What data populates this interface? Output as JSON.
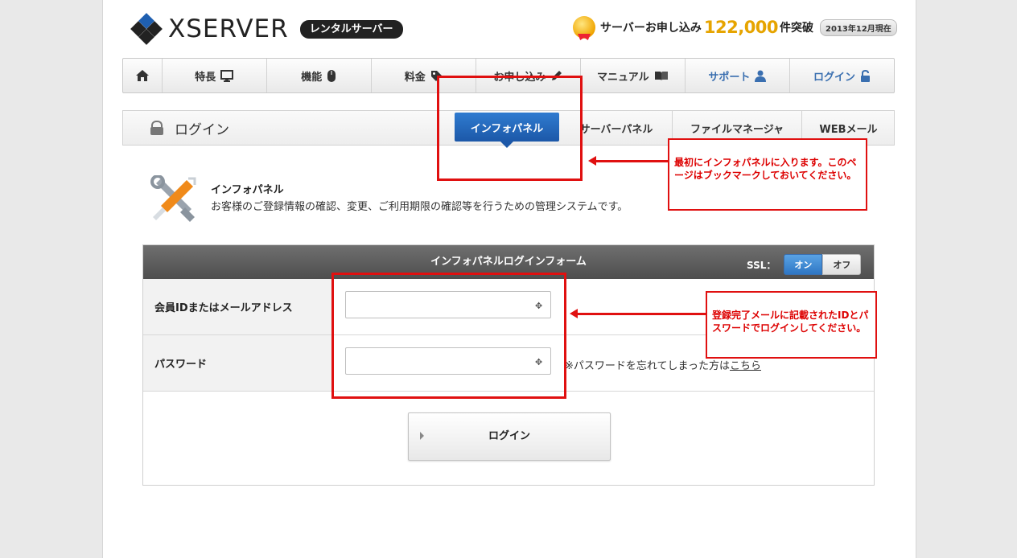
{
  "header": {
    "logo_text": "XSERVER",
    "logo_badge": "レンタルサーバー",
    "promo_text": "サーバーお申し込み",
    "promo_number": "122,000",
    "promo_suffix": "件突破",
    "promo_date": "2013年12月現在"
  },
  "nav": {
    "items": [
      {
        "label": "特長",
        "icon": "monitor-icon"
      },
      {
        "label": "機能",
        "icon": "mouse-icon"
      },
      {
        "label": "料金",
        "icon": "tag-icon"
      },
      {
        "label": "お申し込み",
        "icon": "pencil-icon"
      },
      {
        "label": "マニュアル",
        "icon": "book-icon"
      },
      {
        "label": "サポート",
        "icon": "person-icon"
      },
      {
        "label": "ログイン",
        "icon": "lock-icon"
      }
    ]
  },
  "subnav": {
    "title": "ログイン",
    "tabs": [
      "インフォパネル",
      "サーバーパネル",
      "ファイルマネージャ",
      "WEBメール"
    ]
  },
  "intro": {
    "title": "インフォパネル",
    "desc": "お客様のご登録情報の確認、変更、ご利用期限の確認等を行うための管理システムです。"
  },
  "form": {
    "title": "インフォパネルログインフォーム",
    "ssl_label": "SSL：",
    "ssl_on": "オン",
    "ssl_off": "オフ",
    "id_label": "会員IDまたはメールアドレス",
    "id_value": "",
    "password_label": "パスワード",
    "password_value": "",
    "forgot_text": "※パスワードを忘れてしまった方は",
    "forgot_link": "こちら",
    "login_button": "ログイン"
  },
  "annotations": {
    "note1": "最初にインフォパネルに入ります。このページはブックマークしておいてください。",
    "note2": "登録完了メールに記載されたIDとパスワードでログインしてください。",
    "color": "#e01010"
  }
}
